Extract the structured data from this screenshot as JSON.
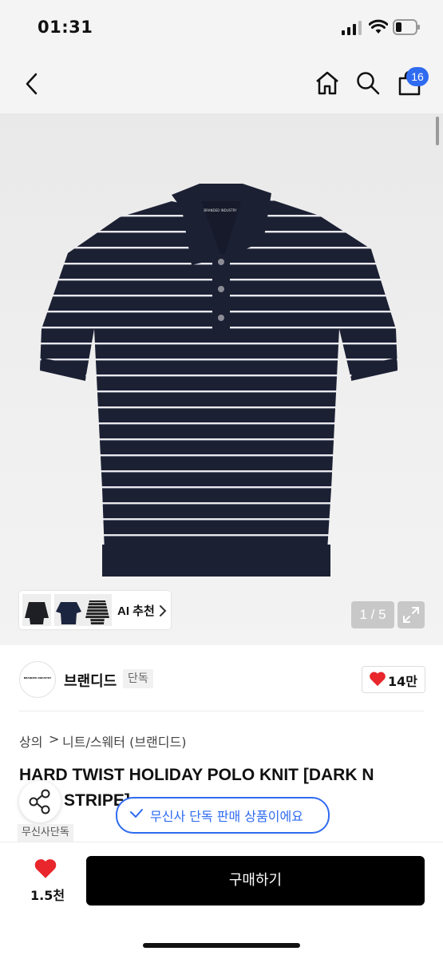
{
  "status_bar": {
    "time": "01:31"
  },
  "nav": {
    "cart_count": "16"
  },
  "gallery": {
    "ai_label": "AI 추천",
    "counter": "1 / 5",
    "shirt_logo_text": "BRANDED INDUSTRY"
  },
  "brand": {
    "name": "브랜디드",
    "exclusive_tag": "단독",
    "like_count": "14만",
    "logo_text": "BRANDED INDUSTRY"
  },
  "breadcrumb": {
    "category": "상의",
    "separator": ">",
    "subcategory": "니트/스웨터 (브랜디드)"
  },
  "product": {
    "title_line1": "HARD TWIST HOLIDAY POLO KNIT [DARK N",
    "title_line2": "STRIPE]",
    "exclusive_small": "무신사단독"
  },
  "toast": {
    "text": "무신사 단독 판매 상품이에요"
  },
  "bottom_bar": {
    "like_count": "1.5천",
    "buy_label": "구매하기"
  },
  "colors": {
    "accent_blue": "#2f6bf0",
    "heart_red": "#e8262b",
    "navy": "#1c2033"
  }
}
